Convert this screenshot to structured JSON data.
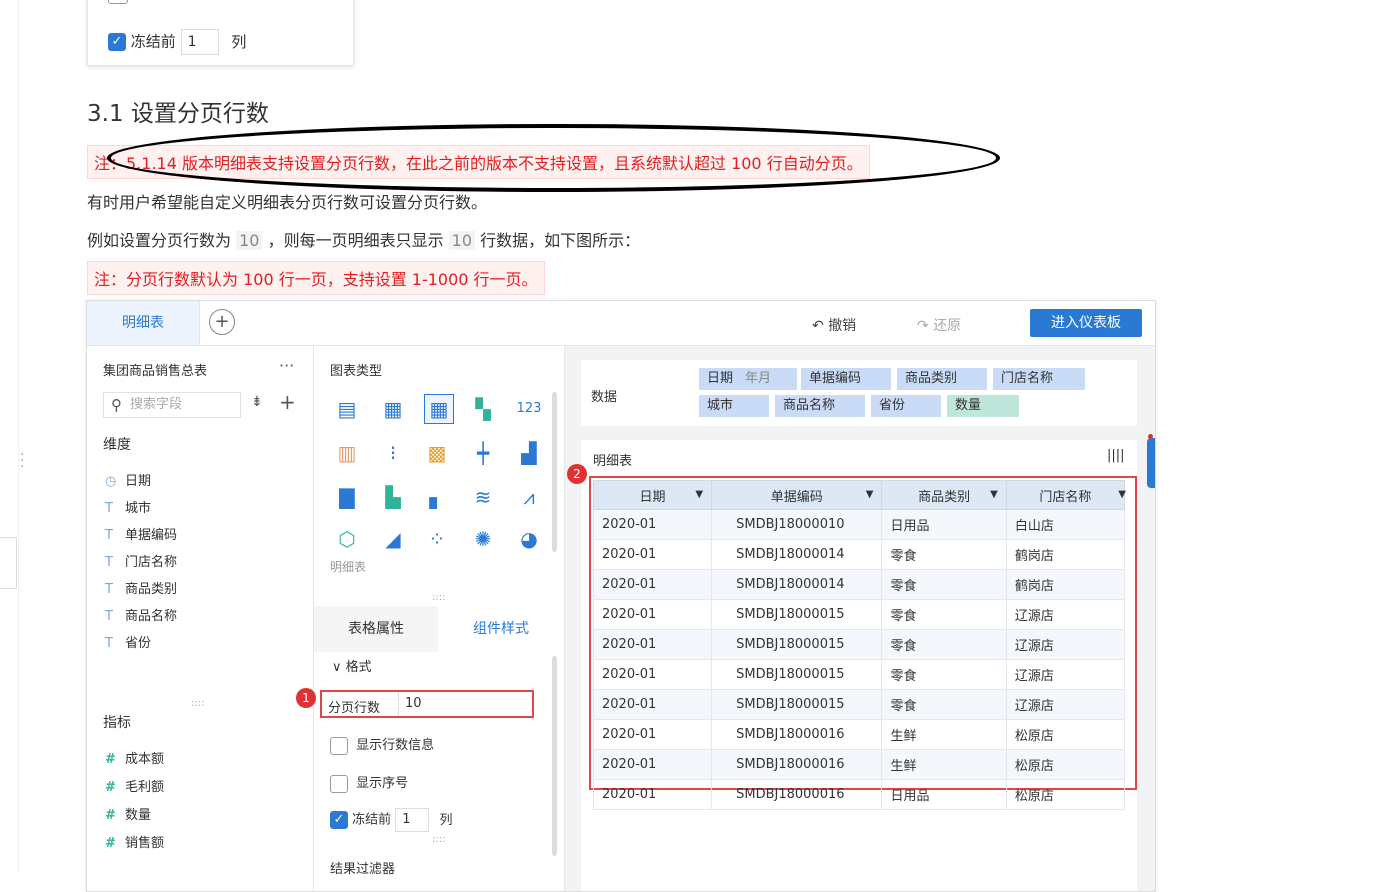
{
  "top_fragment": {
    "freeze_label": "冻结前",
    "freeze_value": "1",
    "freeze_unit": "列"
  },
  "doc": {
    "heading": "3.1 设置分页行数",
    "note1": "注：5.1.14 版本明细表支持设置分页行数，在此之前的版本不支持设置，且系统默认超过 100 行自动分页。",
    "para1": "有时用户希望能自定义明细表分页行数可设置分页行数。",
    "para2_a": "例如设置分页行数为",
    "para2_code1": "10",
    "para2_b": "，则每一页明细表只显示",
    "para2_code2": "10",
    "para2_c": "行数据，如下图所示：",
    "note2": "注：分页行数默认为 100 行一页，支持设置 1-1000 行一页。"
  },
  "app": {
    "tab_label": "明细表",
    "undo_label": "撤销",
    "redo_label": "还原",
    "enter_label": "进入仪表板",
    "left": {
      "title": "集团商品销售总表",
      "more": "···",
      "search_placeholder": "搜索字段",
      "dim_section": "维度",
      "dimensions": [
        "日期",
        "城市",
        "单据编码",
        "门店名称",
        "商品类别",
        "商品名称",
        "省份"
      ],
      "measure_section": "指标",
      "measures": [
        "成本额",
        "毛利额",
        "数量",
        "销售额"
      ]
    },
    "mid": {
      "chart_type_label": "图表类型",
      "chart_name": "明细表",
      "tab_table_props": "表格属性",
      "tab_component_style": "组件样式",
      "format_label": "格式",
      "page_rows_label": "分页行数",
      "page_rows_value": "10",
      "show_rowcount_label": "显示行数信息",
      "show_index_label": "显示序号",
      "freeze_label": "冻结前",
      "freeze_value": "1",
      "freeze_unit": "列",
      "result_filter_label": "结果过滤器"
    },
    "data_panel": {
      "label": "数据",
      "pills_row1": [
        "日期",
        "单据编码",
        "商品类别",
        "门店名称"
      ],
      "pill_date_sub": "年月",
      "pills_row2": [
        "城市",
        "商品名称",
        "省份",
        "数量"
      ]
    },
    "table": {
      "title": "明细表",
      "headers": [
        "日期",
        "单据编码",
        "商品类别",
        "门店名称"
      ],
      "rows": [
        [
          "2020-01",
          "SMDBJ18000010",
          "日用品",
          "白山店"
        ],
        [
          "2020-01",
          "SMDBJ18000014",
          "零食",
          "鹤岗店"
        ],
        [
          "2020-01",
          "SMDBJ18000014",
          "零食",
          "鹤岗店"
        ],
        [
          "2020-01",
          "SMDBJ18000015",
          "零食",
          "辽源店"
        ],
        [
          "2020-01",
          "SMDBJ18000015",
          "零食",
          "辽源店"
        ],
        [
          "2020-01",
          "SMDBJ18000015",
          "零食",
          "辽源店"
        ],
        [
          "2020-01",
          "SMDBJ18000015",
          "零食",
          "辽源店"
        ],
        [
          "2020-01",
          "SMDBJ18000016",
          "生鲜",
          "松原店"
        ],
        [
          "2020-01",
          "SMDBJ18000016",
          "生鲜",
          "松原店"
        ],
        [
          "2020-01",
          "SMDBJ18000016",
          "日用品",
          "松原店"
        ]
      ]
    },
    "badges": [
      "1",
      "2"
    ]
  },
  "colors": {
    "accent": "#2a7ad5",
    "note_red": "#e02020",
    "highlight_box": "#e0454a"
  }
}
